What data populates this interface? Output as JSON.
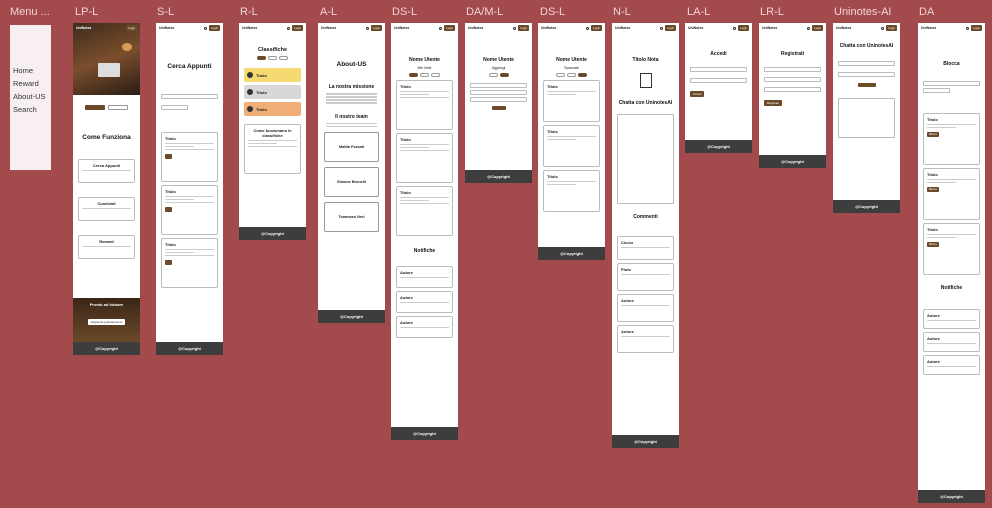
{
  "labels": {
    "menu": "Menu ...",
    "lp": "LP-L",
    "s": "S-L",
    "r": "R-L",
    "a": "A-L",
    "ds1": "DS-L",
    "dam": "DA/M-L",
    "ds2": "DS-L",
    "n": "N-L",
    "la": "LA-L",
    "lr": "LR-L",
    "ai": "Uninotes-AI",
    "da": "DA"
  },
  "menu_items": [
    "Home",
    "Reward",
    "About-US",
    "Search"
  ],
  "common": {
    "copyright": "@Copyright",
    "card_title": "Titolo",
    "author": "Autore",
    "login": "Login"
  },
  "lp": {
    "btn1": "",
    "btn2": "",
    "how": "Come Funziona",
    "features": [
      "Cerca Appunti",
      "Condividi",
      "Reward"
    ],
    "ready": "Pronto ad Iniziare",
    "register": "Registrati gratuitamente"
  },
  "s": {
    "title": "Cerca Appunti"
  },
  "r": {
    "title": "Classifiche",
    "how": "Come funzionano le classifiche"
  },
  "a": {
    "title": "About-US",
    "mission": "La nostra missione",
    "team": "Il nostro team",
    "members": [
      "Mattia Pozzati",
      "Simone Brunelli",
      "Tommaso Neri"
    ]
  },
  "ds1": {
    "name": "Nome Utente",
    "notes": "Mie Note",
    "notif": "Notifiche"
  },
  "dam": {
    "name": "Nome Utente",
    "add": "Aggiungi"
  },
  "ds2": {
    "name": "Nome Utente",
    "dl": "Scaricate"
  },
  "n": {
    "title": "Titolo Nota",
    "chat": "Chatta con UninotesAI",
    "comments": "Commenti",
    "commenters": [
      "Cicciu",
      "Pluto"
    ]
  },
  "la": {
    "title": "Accedi",
    "btn": "Accedi"
  },
  "lr": {
    "title": "Registrati",
    "btn": "Registrati"
  },
  "ai": {
    "title": "Chatta con UninotesAI"
  },
  "da": {
    "title": "Blocca",
    "notif": "Notifiche",
    "block": "Blocca"
  }
}
